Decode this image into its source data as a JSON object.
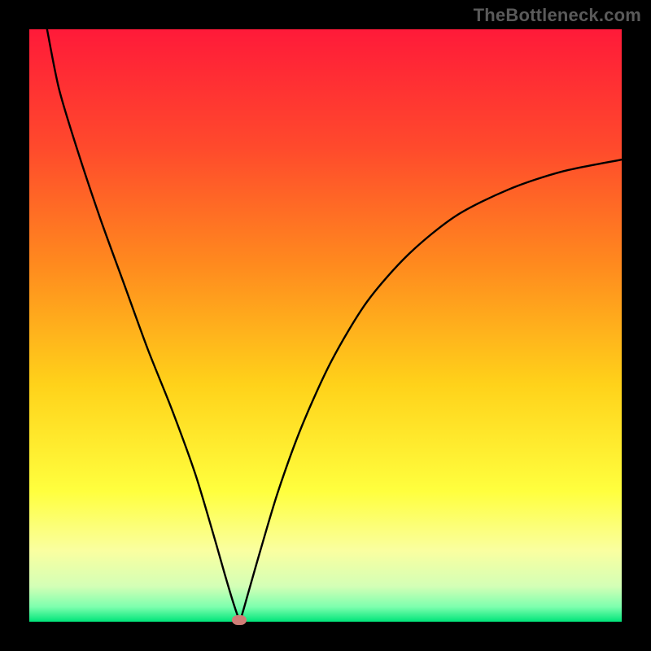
{
  "watermark": "TheBottleneck.com",
  "chart_data": {
    "type": "line",
    "title": "",
    "xlabel": "",
    "ylabel": "",
    "xlim": [
      0,
      100
    ],
    "ylim": [
      0,
      100
    ],
    "grid": false,
    "legend": false,
    "gradient_stops": [
      {
        "offset": 0.0,
        "color": "#ff1a39"
      },
      {
        "offset": 0.2,
        "color": "#ff4a2c"
      },
      {
        "offset": 0.4,
        "color": "#ff8b1e"
      },
      {
        "offset": 0.6,
        "color": "#ffd21a"
      },
      {
        "offset": 0.78,
        "color": "#ffff3e"
      },
      {
        "offset": 0.88,
        "color": "#faffa0"
      },
      {
        "offset": 0.94,
        "color": "#d4ffb6"
      },
      {
        "offset": 0.975,
        "color": "#7dffae"
      },
      {
        "offset": 1.0,
        "color": "#00e57a"
      }
    ],
    "series": [
      {
        "name": "bottleneck-curve",
        "x": [
          3,
          5,
          8,
          12,
          16,
          20,
          24,
          28,
          31,
          33,
          34.5,
          35.5,
          36,
          37,
          39,
          42,
          46,
          51,
          57,
          64,
          72,
          81,
          90,
          100
        ],
        "y": [
          100,
          90,
          80,
          68,
          57,
          46,
          36,
          25,
          15,
          8,
          3,
          0.3,
          1.5,
          5,
          12,
          22,
          33,
          44,
          54,
          62,
          68.5,
          73,
          76,
          78
        ]
      }
    ],
    "marker": {
      "x": 35.4,
      "y": 0.25,
      "color": "#cf7d76"
    }
  }
}
